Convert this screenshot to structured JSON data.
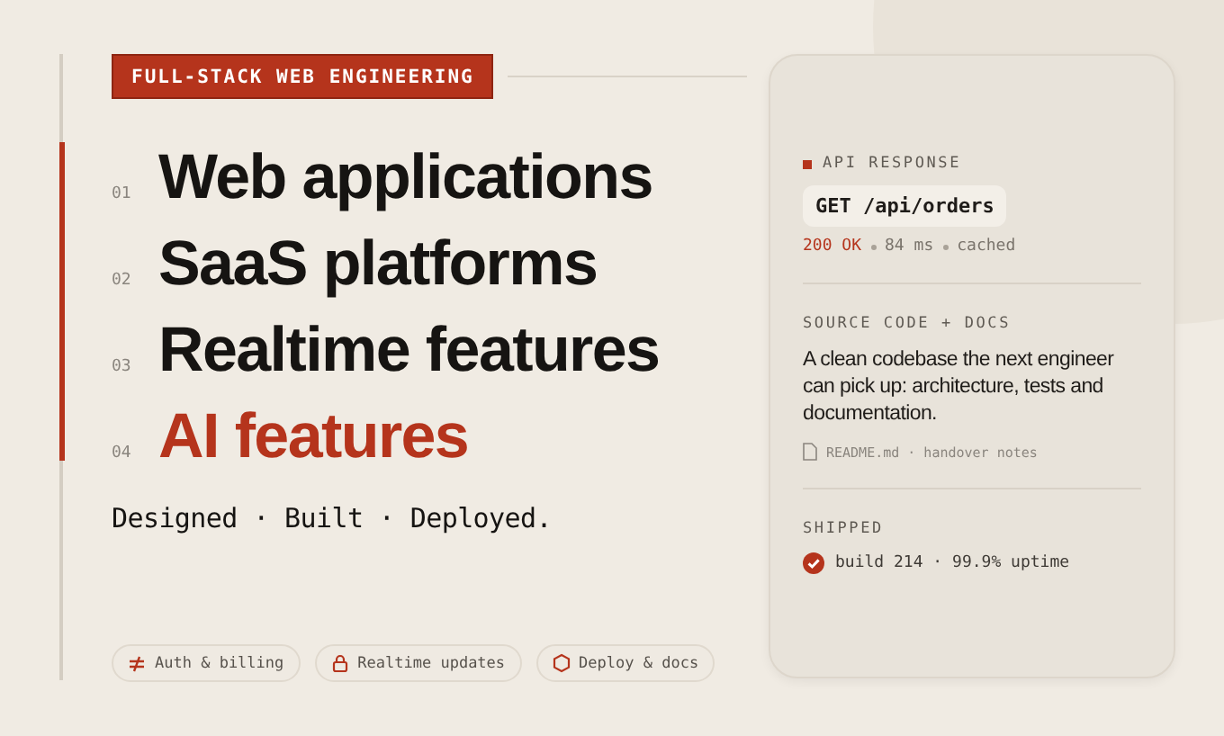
{
  "tag": "FULL-STACK WEB ENGINEERING",
  "services": [
    {
      "number": "01",
      "title": "Web applications",
      "selected": false
    },
    {
      "number": "02",
      "title": "SaaS platforms",
      "selected": false
    },
    {
      "number": "03",
      "title": "Realtime features",
      "selected": false
    },
    {
      "number": "04",
      "title": "AI features",
      "selected": true
    }
  ],
  "tagline": "Designed · Built · Deployed.",
  "chips": [
    {
      "kind": "split",
      "label": "Auth & billing"
    },
    {
      "kind": "lock",
      "label": "Realtime updates"
    },
    {
      "kind": "hexagon",
      "label": "Deploy & docs"
    }
  ],
  "card": {
    "api": {
      "heading": "API RESPONSE",
      "request": "GET /api/orders",
      "status": "200 OK",
      "time": "84 ms",
      "cache": "cached"
    },
    "source": {
      "heading": "SOURCE CODE + DOCS",
      "text": "A clean codebase the next engineer can pick up: architecture, tests and documentation.",
      "file": "README.md · handover notes"
    },
    "shipped": {
      "heading": "SHIPPED",
      "text": "build 214 · 99.9% uptime"
    }
  }
}
